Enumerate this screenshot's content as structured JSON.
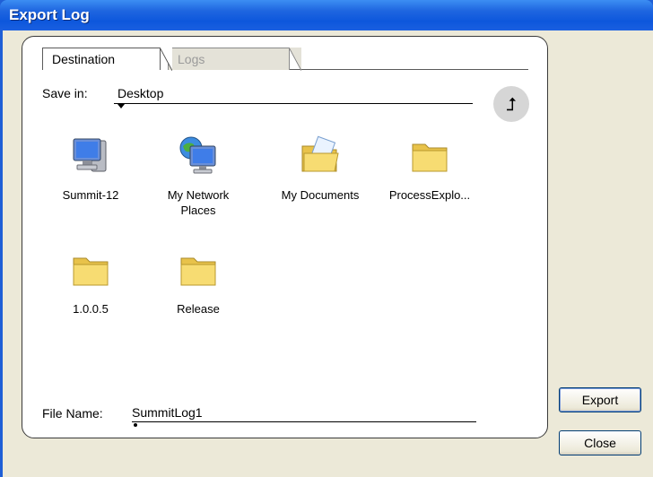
{
  "window": {
    "title": "Export Log"
  },
  "tabs": [
    {
      "label": "Destination",
      "active": true
    },
    {
      "label": "Logs",
      "active": false
    }
  ],
  "save_in": {
    "label": "Save in:",
    "value": "Desktop"
  },
  "items": [
    {
      "label": "Summit-12",
      "icon": "computer-icon"
    },
    {
      "label": "My Network Places",
      "icon": "network-places-icon"
    },
    {
      "label": "My Documents",
      "icon": "my-documents-icon"
    },
    {
      "label": "ProcessExplo...",
      "icon": "folder-icon"
    },
    {
      "label": "1.0.0.5",
      "icon": "folder-icon"
    },
    {
      "label": "Release",
      "icon": "folder-icon"
    }
  ],
  "file_name": {
    "label": "File Name:",
    "value": "SummitLog1"
  },
  "buttons": {
    "export": "Export",
    "close": "Close"
  },
  "colors": {
    "titlebar": "#0d57dc",
    "window_bg": "#ece9d8",
    "folder": "#f5d96b"
  }
}
